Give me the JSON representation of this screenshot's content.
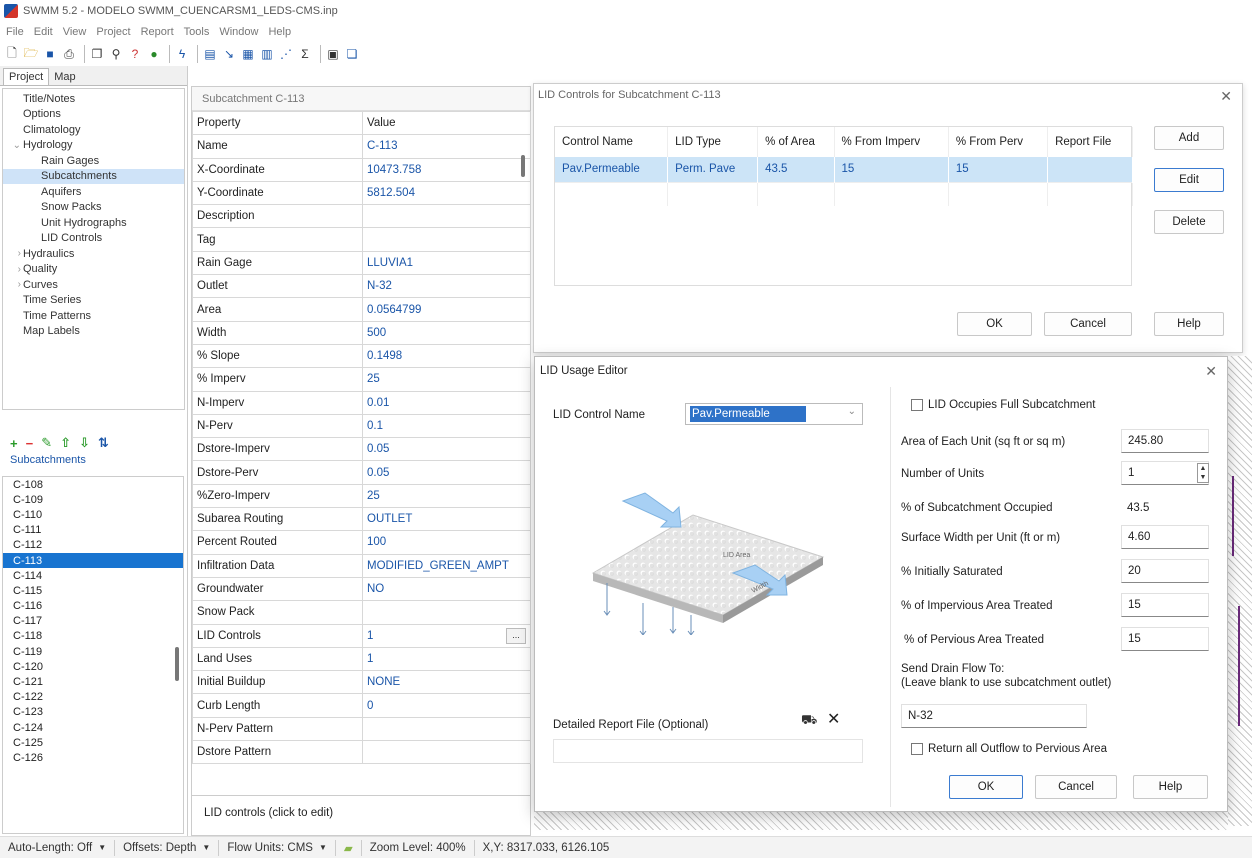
{
  "window": {
    "title": "SWMM 5.2 - MODELO SWMM_CUENCARSM1_LEDS-CMS.inp"
  },
  "menu": [
    "File",
    "Edit",
    "View",
    "Project",
    "Report",
    "Tools",
    "Window",
    "Help"
  ],
  "project_panel": {
    "tabs": [
      "Project",
      "Map"
    ],
    "tree": [
      {
        "label": "Title/Notes",
        "lead": "",
        "indent": 0
      },
      {
        "label": "Options",
        "lead": "",
        "indent": 0
      },
      {
        "label": "Climatology",
        "lead": "",
        "indent": 0
      },
      {
        "label": "Hydrology",
        "lead": "⌄",
        "indent": 0
      },
      {
        "label": "Rain Gages",
        "lead": "",
        "indent": 1
      },
      {
        "label": "Subcatchments",
        "lead": "",
        "indent": 1,
        "selected": true
      },
      {
        "label": "Aquifers",
        "lead": "",
        "indent": 1
      },
      {
        "label": "Snow Packs",
        "lead": "",
        "indent": 1
      },
      {
        "label": "Unit Hydrographs",
        "lead": "",
        "indent": 1
      },
      {
        "label": "LID Controls",
        "lead": "",
        "indent": 1
      },
      {
        "label": "Hydraulics",
        "lead": "›",
        "indent": 0
      },
      {
        "label": "Quality",
        "lead": "›",
        "indent": 0
      },
      {
        "label": "Curves",
        "lead": "›",
        "indent": 0
      },
      {
        "label": "Time Series",
        "lead": "",
        "indent": 0
      },
      {
        "label": "Time Patterns",
        "lead": "",
        "indent": 0
      },
      {
        "label": "Map Labels",
        "lead": "",
        "indent": 0
      }
    ],
    "object_label": "Subcatchments",
    "objects": [
      "C-108",
      "C-109",
      "C-110",
      "C-111",
      "C-112",
      "C-113",
      "C-114",
      "C-115",
      "C-116",
      "C-117",
      "C-118",
      "C-119",
      "C-120",
      "C-121",
      "C-122",
      "C-123",
      "C-124",
      "C-125",
      "C-126"
    ],
    "selected_object": "C-113"
  },
  "property_editor": {
    "title": "Subcatchment C-113",
    "header": {
      "property": "Property",
      "value": "Value"
    },
    "rows": [
      {
        "k": "Name",
        "v": "C-113"
      },
      {
        "k": "X-Coordinate",
        "v": "10473.758"
      },
      {
        "k": "Y-Coordinate",
        "v": "5812.504"
      },
      {
        "k": "Description",
        "v": ""
      },
      {
        "k": "Tag",
        "v": ""
      },
      {
        "k": "Rain Gage",
        "v": "LLUVIA1"
      },
      {
        "k": "Outlet",
        "v": "N-32"
      },
      {
        "k": "Area",
        "v": "0.0564799"
      },
      {
        "k": "Width",
        "v": "500"
      },
      {
        "k": "% Slope",
        "v": "0.1498"
      },
      {
        "k": "% Imperv",
        "v": "25"
      },
      {
        "k": "N-Imperv",
        "v": "0.01"
      },
      {
        "k": "N-Perv",
        "v": "0.1"
      },
      {
        "k": "Dstore-Imperv",
        "v": "0.05"
      },
      {
        "k": "Dstore-Perv",
        "v": "0.05"
      },
      {
        "k": "%Zero-Imperv",
        "v": "25"
      },
      {
        "k": "Subarea Routing",
        "v": "OUTLET"
      },
      {
        "k": "Percent Routed",
        "v": "100"
      },
      {
        "k": "Infiltration Data",
        "v": "MODIFIED_GREEN_AMPT"
      },
      {
        "k": "Groundwater",
        "v": "NO"
      },
      {
        "k": "Snow Pack",
        "v": ""
      },
      {
        "k": "LID Controls",
        "v": "1",
        "ellipsis": "..."
      },
      {
        "k": "Land Uses",
        "v": "1"
      },
      {
        "k": "Initial Buildup",
        "v": "NONE"
      },
      {
        "k": "Curb Length",
        "v": "0"
      },
      {
        "k": "N-Perv Pattern",
        "v": ""
      },
      {
        "k": "Dstore Pattern",
        "v": ""
      }
    ],
    "hint": "LID controls (click to edit)"
  },
  "lid_controls_dialog": {
    "title": "LID Controls for Subcatchment C-113",
    "columns": [
      "Control Name",
      "LID Type",
      "% of Area",
      "% From Imperv",
      "% From Perv",
      "Report File"
    ],
    "rows": [
      [
        "Pav.Permeable",
        "Perm. Pave",
        "43.5",
        "15",
        "15",
        ""
      ]
    ],
    "buttons": {
      "add": "Add",
      "edit": "Edit",
      "delete": "Delete",
      "ok": "OK",
      "cancel": "Cancel",
      "help": "Help"
    }
  },
  "lid_usage_editor": {
    "title": "LID Usage Editor",
    "control_name_label": "LID Control Name",
    "control_name_value": "Pav.Permeable",
    "diagram_area_label": "LID Area",
    "diagram_width_label": "Width",
    "report_file_label": "Detailed Report File (Optional)",
    "report_file_value": "",
    "occupies_full_label": "LID Occupies Full Subcatchment",
    "occupies_full_checked": false,
    "area_unit_label": "Area of Each Unit (sq ft or sq m)",
    "area_unit_value": "245.80",
    "num_units_label": "Number of Units",
    "num_units_value": "1",
    "pct_occupied_label": "% of Subcatchment Occupied",
    "pct_occupied_value": "43.5",
    "surface_width_label": "Surface Width per Unit (ft or m)",
    "surface_width_value": "4.60",
    "init_sat_label": "% Initially Saturated",
    "init_sat_value": "20",
    "imperv_treated_label": "% of Impervious Area Treated",
    "imperv_treated_value": "15",
    "perv_treated_label": "% of Pervious Area Treated",
    "perv_treated_value": "15",
    "drain_label_1": "Send Drain Flow To:",
    "drain_label_2": "(Leave blank to use subcatchment outlet)",
    "drain_value": "N-32",
    "return_outflow_label": "Return all Outflow to Pervious Area",
    "return_outflow_checked": false,
    "buttons": {
      "ok": "OK",
      "cancel": "Cancel",
      "help": "Help"
    }
  },
  "status_bar": {
    "auto_length": "Auto-Length: Off",
    "offsets": "Offsets: Depth",
    "flow_units": "Flow Units: CMS",
    "zoom": "Zoom Level: 400%",
    "xy": "X,Y: 8317.033, 6126.105"
  },
  "colors": {
    "accent": "#1874d0",
    "value_blue": "#1a55a8",
    "selection_light": "#cce4f7"
  }
}
